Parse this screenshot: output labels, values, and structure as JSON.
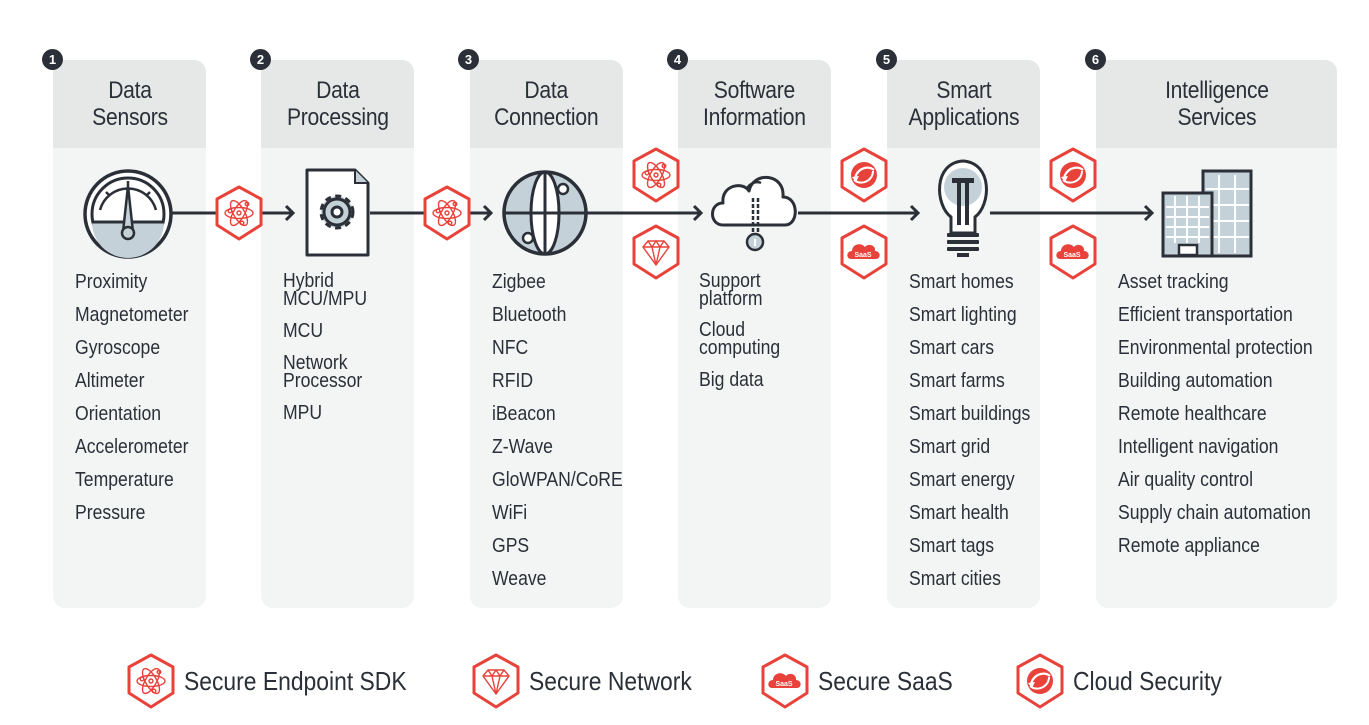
{
  "colors": {
    "accent": "#e8423a",
    "ink": "#2b3038",
    "panel": "#f3f4f4",
    "panel_head": "#e6e8e8",
    "icon_fill": "#c5d1d8"
  },
  "stages": [
    {
      "number": "1",
      "title": [
        "Data",
        "Sensors"
      ],
      "icon": "gauge-icon",
      "items": [
        "Proximity",
        "Magnetometer",
        "Gyroscope",
        "Altimeter",
        "Orientation",
        "Accelerometer",
        "Temperature",
        "Pressure"
      ]
    },
    {
      "number": "2",
      "title": [
        "Data",
        "Processing"
      ],
      "icon": "gear-document-icon",
      "items": [
        "Hybrid MCU/MPU",
        "MCU",
        "Network Processor",
        "MPU"
      ]
    },
    {
      "number": "3",
      "title": [
        "Data",
        "Connection"
      ],
      "icon": "globe-icon",
      "items": [
        "Zigbee",
        "Bluetooth",
        "NFC",
        "RFID",
        "iBeacon",
        "Z-Wave",
        "GloWPAN/CoRE",
        "WiFi",
        "GPS",
        "Weave"
      ]
    },
    {
      "number": "4",
      "title": [
        "Software",
        "Information"
      ],
      "icon": "cloud-info-icon",
      "items": [
        "Support platform",
        "Cloud computing",
        "Big data"
      ]
    },
    {
      "number": "5",
      "title": [
        "Smart",
        "Applications"
      ],
      "icon": "lightbulb-icon",
      "items": [
        "Smart homes",
        "Smart lighting",
        "Smart cars",
        "Smart farms",
        "Smart buildings",
        "Smart grid",
        "Smart energy",
        "Smart health",
        "Smart tags",
        "Smart cities"
      ]
    },
    {
      "number": "6",
      "title": [
        "Intelligence",
        "Services"
      ],
      "icon": "buildings-icon",
      "items": [
        "Asset tracking",
        "Efficient transportation",
        "Environmental protection",
        "Building automation",
        "Remote healthcare",
        "Intelligent navigation",
        "Air quality control",
        "Supply chain automation",
        "Remote appliance"
      ]
    }
  ],
  "connectors": [
    {
      "between": "1-2",
      "shields": [
        "atom-shield-icon"
      ]
    },
    {
      "between": "2-3",
      "shields": [
        "atom-shield-icon"
      ]
    },
    {
      "between": "3-4",
      "shields": [
        "atom-shield-icon",
        "diamond-shield-icon"
      ]
    },
    {
      "between": "4-5",
      "shields": [
        "cloud-security-shield-icon",
        "saas-shield-icon"
      ]
    },
    {
      "between": "5-6",
      "shields": [
        "cloud-security-shield-icon",
        "saas-shield-icon"
      ]
    }
  ],
  "saas_badge_text": "SaaS",
  "legend": [
    {
      "icon": "atom-shield-icon",
      "label": "Secure Endpoint SDK"
    },
    {
      "icon": "diamond-shield-icon",
      "label": "Secure Network"
    },
    {
      "icon": "saas-shield-icon",
      "label": "Secure SaaS"
    },
    {
      "icon": "cloud-security-shield-icon",
      "label": "Cloud Security"
    }
  ]
}
